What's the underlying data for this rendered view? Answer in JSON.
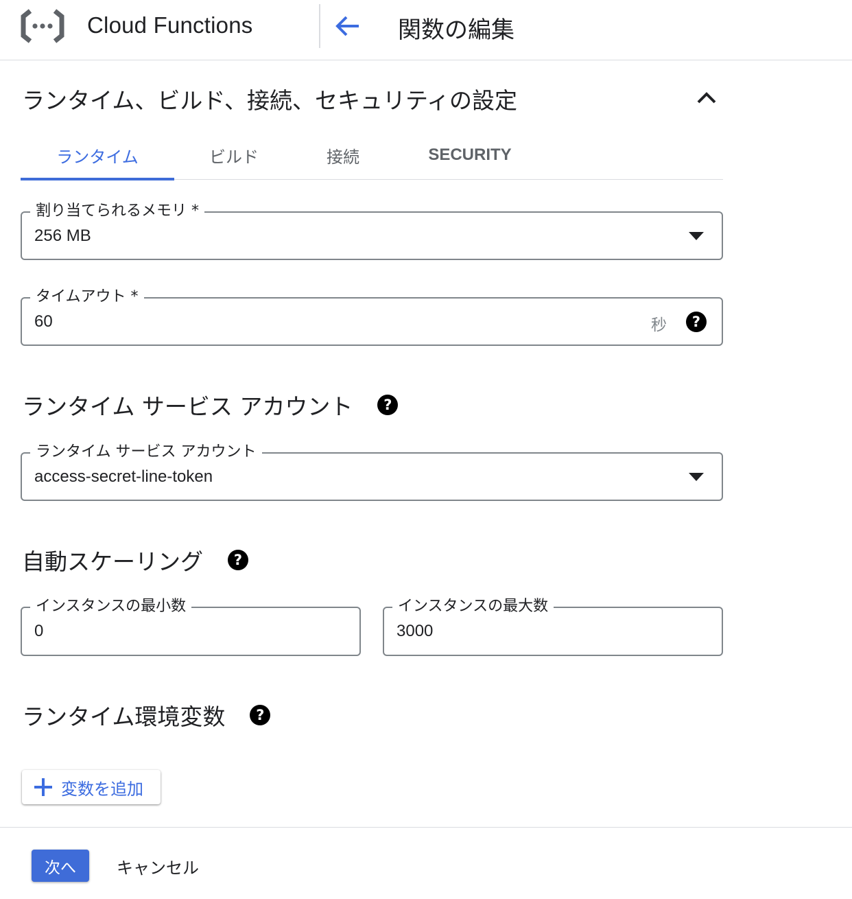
{
  "header": {
    "app_title": "Cloud Functions",
    "page_title": "関数の編集"
  },
  "section": {
    "title": "ランタイム、ビルド、接続、セキュリティの設定"
  },
  "tabs": [
    {
      "label": "ランタイム",
      "active": true
    },
    {
      "label": "ビルド",
      "active": false
    },
    {
      "label": "接続",
      "active": false
    },
    {
      "label": "SECURITY",
      "active": false
    }
  ],
  "memory": {
    "label": "割り当てられるメモリ *",
    "value": "256 MB"
  },
  "timeout": {
    "label": "タイムアウト *",
    "value": "60",
    "suffix": "秒"
  },
  "service_account": {
    "heading": "ランタイム サービス アカウント",
    "label": "ランタイム サービス アカウント",
    "value": "access-secret-line-token"
  },
  "autoscaling": {
    "heading": "自動スケーリング",
    "min_label": "インスタンスの最小数",
    "min_value": "0",
    "max_label": "インスタンスの最大数",
    "max_value": "3000"
  },
  "env_vars": {
    "heading": "ランタイム環境変数",
    "add_label": "変数を追加"
  },
  "footer": {
    "next_label": "次へ",
    "cancel_label": "キャンセル"
  },
  "colors": {
    "accent": "#3f6cd8",
    "text": "#202124",
    "muted": "#5f6368",
    "border": "#80868b",
    "divider": "#dadce0"
  },
  "icons": {
    "logo": "cloud-functions-logo",
    "back": "arrow-left-icon",
    "collapse": "chevron-up-icon",
    "help": "help-circle-icon",
    "dropdown": "dropdown-arrow-icon",
    "add": "plus-icon"
  }
}
